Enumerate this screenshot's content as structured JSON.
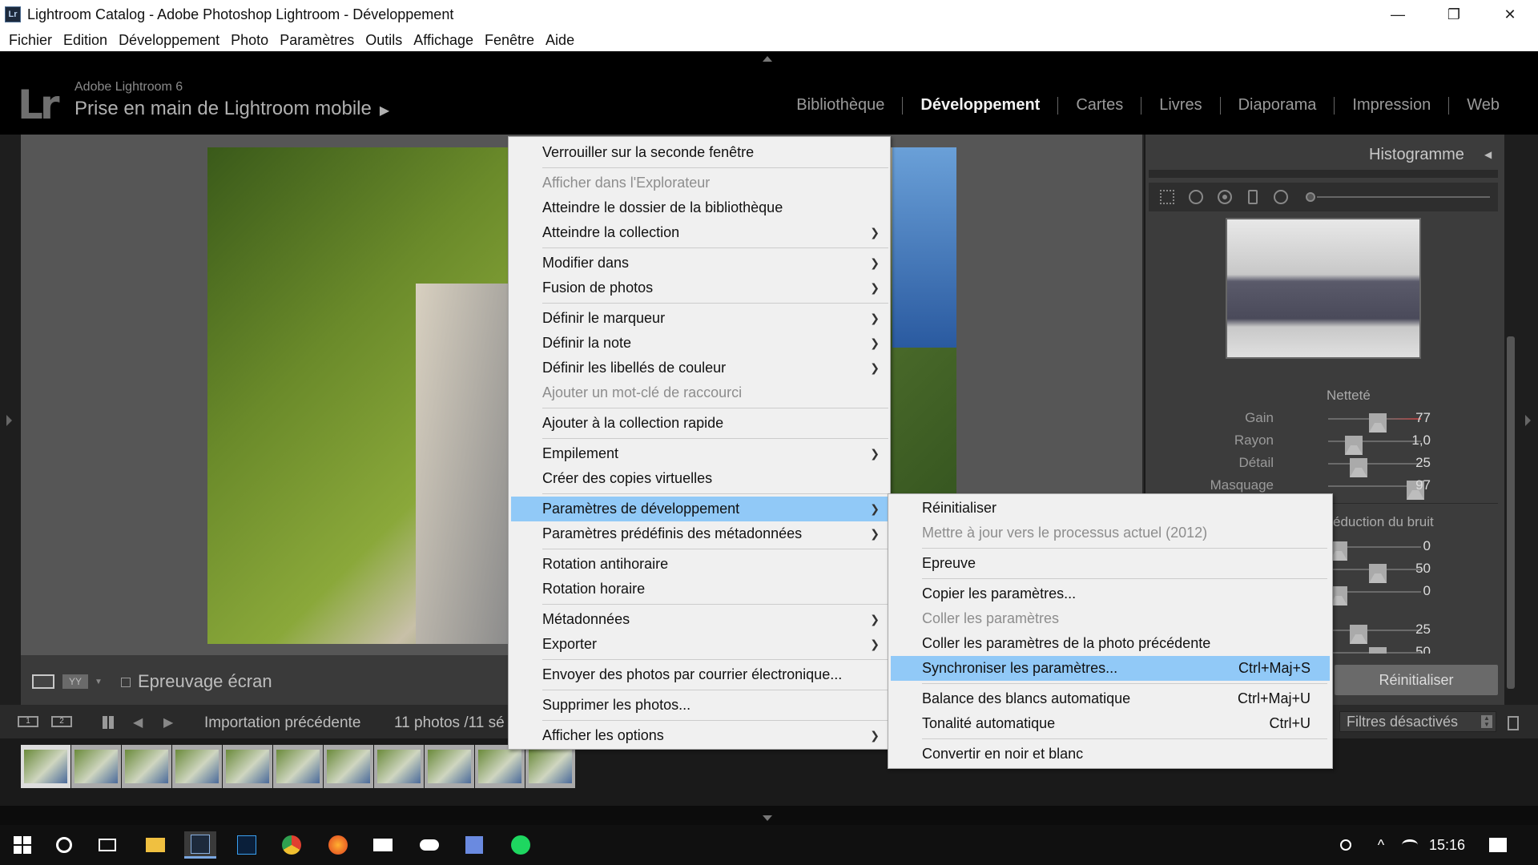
{
  "window": {
    "badge": "Lr",
    "title": "Lightroom Catalog - Adobe Photoshop Lightroom - Développement",
    "controls": [
      "—",
      "❐",
      "✕"
    ]
  },
  "menubar": [
    "Fichier",
    "Edition",
    "Développement",
    "Photo",
    "Paramètres",
    "Outils",
    "Affichage",
    "Fenêtre",
    "Aide"
  ],
  "header": {
    "logo": "Lr",
    "version": "Adobe Lightroom 6",
    "identity": "Prise en main de Lightroom mobile",
    "identity_arrow": "▶",
    "modules": [
      "Bibliothèque",
      "Développement",
      "Cartes",
      "Livres",
      "Diaporama",
      "Impression",
      "Web"
    ],
    "active_module": "Développement"
  },
  "toolbar": {
    "yy_label": "YY",
    "softproof": "Epreuvage écran"
  },
  "right_panel": {
    "histogram_title": "Histogramme",
    "sharpening_title": "Netteté",
    "sharpening": [
      {
        "label": "Gain",
        "value": "77",
        "pos": 0.42
      },
      {
        "label": "Rayon",
        "value": "1,0",
        "pos": 0.2
      },
      {
        "label": "Détail",
        "value": "25",
        "pos": 0.25
      },
      {
        "label": "Masquage",
        "value": "97",
        "pos": 0.9
      }
    ],
    "noise_title": "éduction du bruit",
    "noise_values": [
      "0",
      "50",
      "0",
      "25",
      "50"
    ],
    "reset_button": "Réinitialiser"
  },
  "filmstrip": {
    "view1": "1",
    "view2": "2",
    "source": "Importation précédente",
    "count": "11 photos /11 sé",
    "filter": "Filtres désactivés",
    "thumb_count": 11
  },
  "context_menu": {
    "items": [
      {
        "label": "Verrouiller sur la seconde fenêtre",
        "disabled": false,
        "submenu": false
      },
      {
        "sep": true
      },
      {
        "label": "Afficher dans l'Explorateur",
        "disabled": true,
        "submenu": false
      },
      {
        "label": "Atteindre le dossier de la bibliothèque",
        "disabled": false,
        "submenu": false
      },
      {
        "label": "Atteindre la collection",
        "disabled": false,
        "submenu": true
      },
      {
        "sep": true
      },
      {
        "label": "Modifier dans",
        "disabled": false,
        "submenu": true
      },
      {
        "label": "Fusion de photos",
        "disabled": false,
        "submenu": true
      },
      {
        "sep": true
      },
      {
        "label": "Définir le marqueur",
        "disabled": false,
        "submenu": true
      },
      {
        "label": "Définir la note",
        "disabled": false,
        "submenu": true
      },
      {
        "label": "Définir les libellés de couleur",
        "disabled": false,
        "submenu": true
      },
      {
        "label": "Ajouter un mot-clé de raccourci",
        "disabled": true,
        "submenu": false
      },
      {
        "sep": true
      },
      {
        "label": "Ajouter à la collection rapide",
        "disabled": false,
        "submenu": false
      },
      {
        "sep": true
      },
      {
        "label": "Empilement",
        "disabled": false,
        "submenu": true
      },
      {
        "label": "Créer des copies virtuelles",
        "disabled": false,
        "submenu": false
      },
      {
        "sep": true
      },
      {
        "label": "Paramètres de développement",
        "disabled": false,
        "submenu": true,
        "highlighted": true
      },
      {
        "label": "Paramètres prédéfinis des métadonnées",
        "disabled": false,
        "submenu": true
      },
      {
        "sep": true
      },
      {
        "label": "Rotation antihoraire",
        "disabled": false,
        "submenu": false
      },
      {
        "label": "Rotation horaire",
        "disabled": false,
        "submenu": false
      },
      {
        "sep": true
      },
      {
        "label": "Métadonnées",
        "disabled": false,
        "submenu": true
      },
      {
        "label": "Exporter",
        "disabled": false,
        "submenu": true
      },
      {
        "sep": true
      },
      {
        "label": "Envoyer des photos par courrier électronique...",
        "disabled": false,
        "submenu": false
      },
      {
        "sep": true
      },
      {
        "label": "Supprimer les photos...",
        "disabled": false,
        "submenu": false
      },
      {
        "sep": true
      },
      {
        "label": "Afficher les options",
        "disabled": false,
        "submenu": true
      }
    ]
  },
  "submenu": {
    "items": [
      {
        "label": "Réinitialiser",
        "disabled": false
      },
      {
        "label": "Mettre à jour vers le processus actuel (2012)",
        "disabled": true
      },
      {
        "sep": true
      },
      {
        "label": "Epreuve",
        "disabled": false
      },
      {
        "sep": true
      },
      {
        "label": "Copier les paramètres...",
        "disabled": false
      },
      {
        "label": "Coller les paramètres",
        "disabled": true
      },
      {
        "label": "Coller les paramètres de la photo précédente",
        "disabled": false
      },
      {
        "label": "Synchroniser les paramètres...",
        "disabled": false,
        "shortcut": "Ctrl+Maj+S",
        "highlighted": true
      },
      {
        "sep": true
      },
      {
        "label": "Balance des blancs automatique",
        "disabled": false,
        "shortcut": "Ctrl+Maj+U"
      },
      {
        "label": "Tonalité automatique",
        "disabled": false,
        "shortcut": "Ctrl+U"
      },
      {
        "sep": true
      },
      {
        "label": "Convertir en noir et blanc",
        "disabled": false
      }
    ]
  },
  "taskbar": {
    "clock": "15:16"
  },
  "colors": {
    "menu_highlight": "#91c9f7",
    "menu_bg": "#f0f0f0",
    "disabled_text": "#8d8d8d"
  }
}
